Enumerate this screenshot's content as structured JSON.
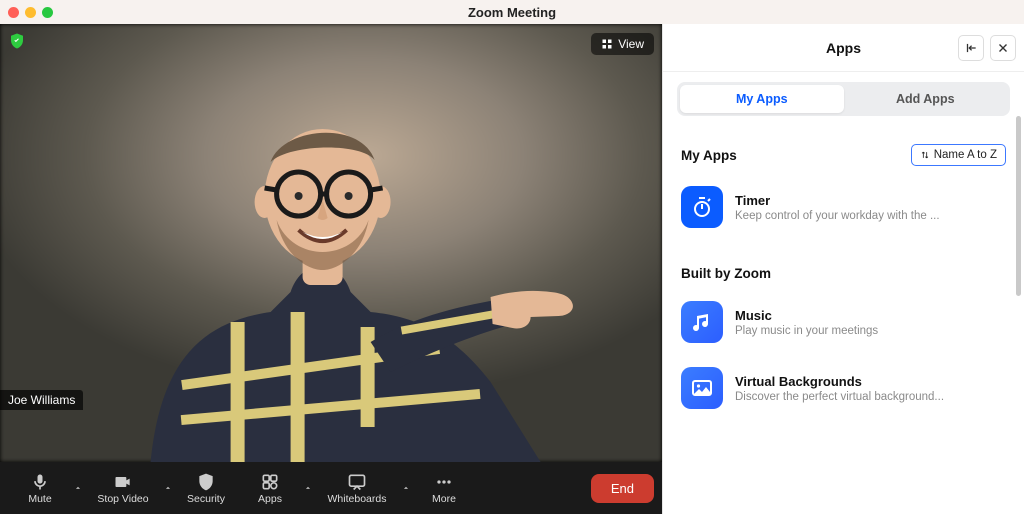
{
  "window": {
    "title": "Zoom Meeting"
  },
  "video": {
    "view_label": "View",
    "participant_name": "Joe Williams"
  },
  "toolbar": {
    "mute": "Mute",
    "stop_video": "Stop Video",
    "security": "Security",
    "apps": "Apps",
    "whiteboards": "Whiteboards",
    "more": "More",
    "end": "End"
  },
  "apps_panel": {
    "title": "Apps",
    "tabs": {
      "my_apps": "My Apps",
      "add_apps": "Add Apps"
    },
    "sort_label": "Name A to Z",
    "sections": {
      "my_apps": {
        "title": "My Apps"
      },
      "built_by_zoom": {
        "title": "Built by Zoom"
      }
    },
    "apps": {
      "timer": {
        "name": "Timer",
        "desc": "Keep control of your workday with the ..."
      },
      "music": {
        "name": "Music",
        "desc": "Play music in your meetings"
      },
      "virtual_bg": {
        "name": "Virtual Backgrounds",
        "desc": "Discover the perfect virtual background..."
      }
    }
  }
}
